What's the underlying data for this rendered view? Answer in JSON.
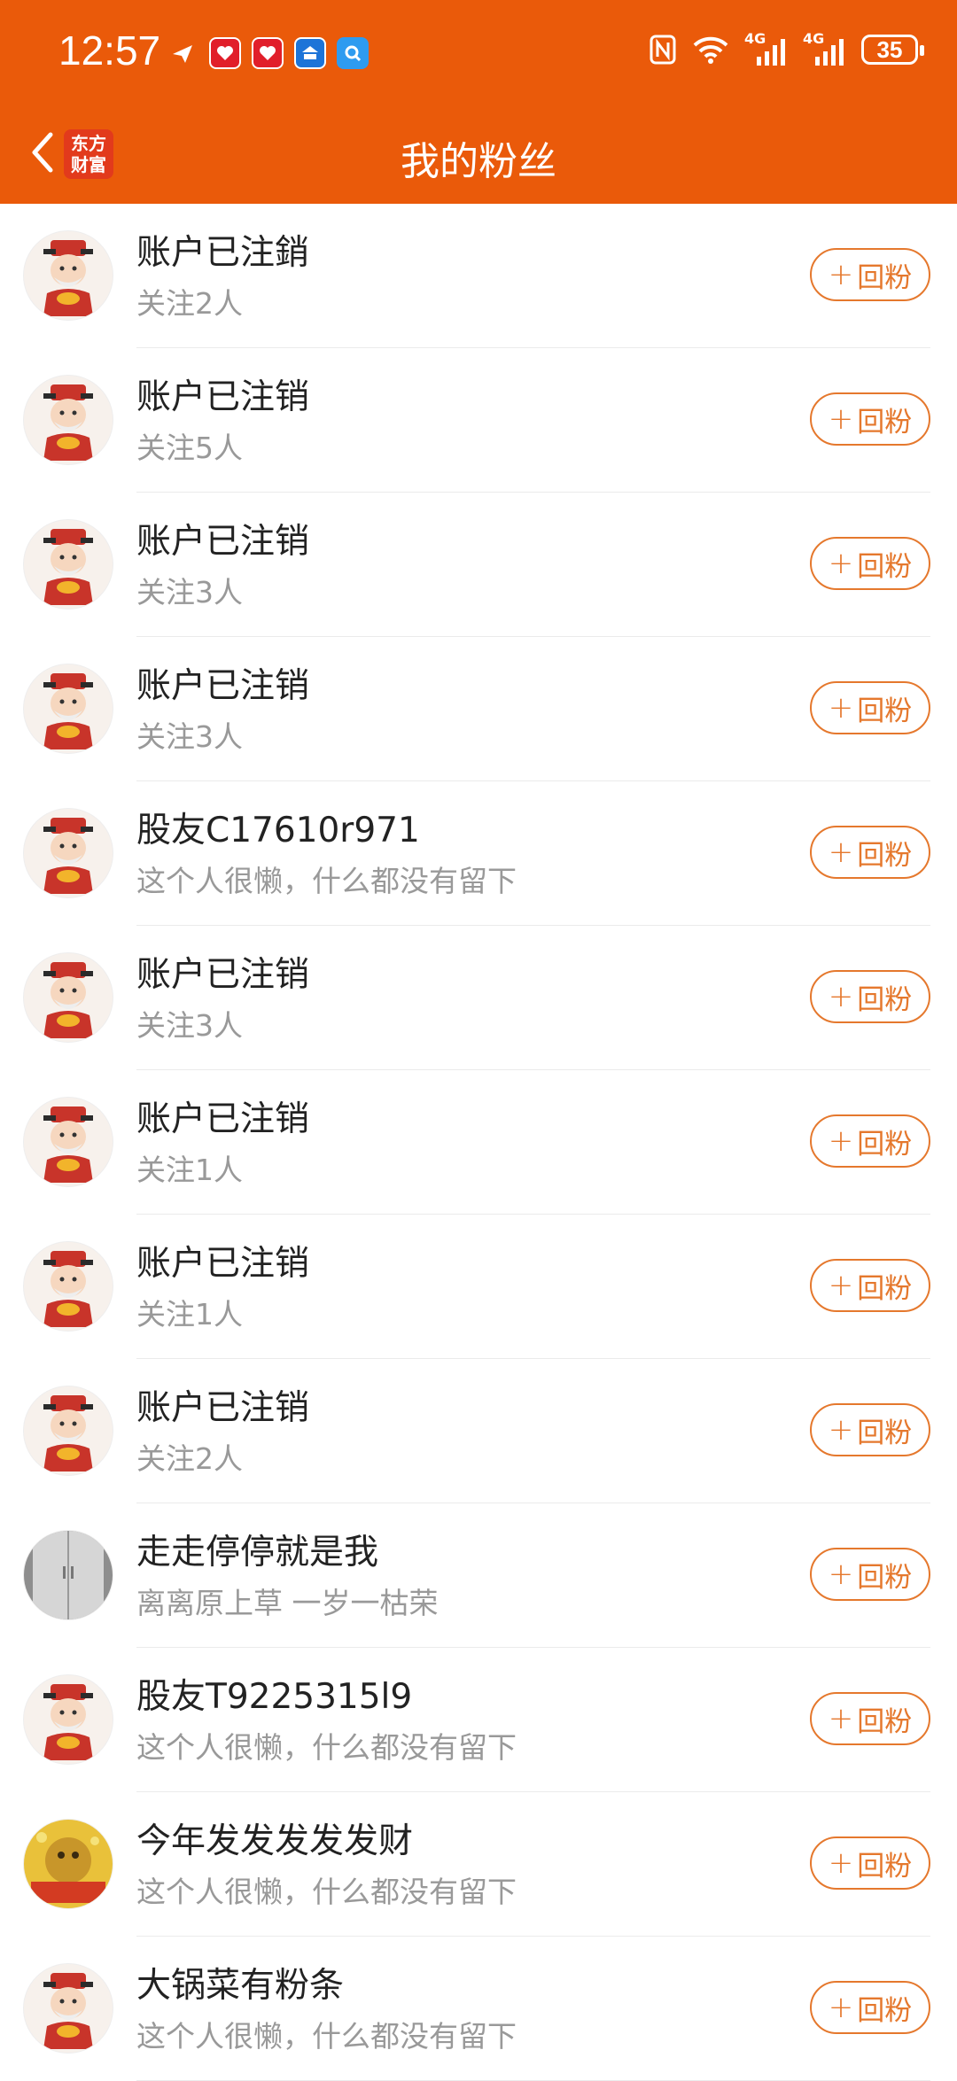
{
  "status_bar": {
    "time": "12:57",
    "battery": "35",
    "network_1": "4G",
    "network_2": "4G"
  },
  "header": {
    "title": "我的粉丝",
    "logo_line1": "东方",
    "logo_line2": "财富"
  },
  "colors": {
    "header_bg": "#EA5A0A",
    "accent": "#E5782D"
  },
  "follow_plus": "+",
  "fans": [
    {
      "name": "账户已注銷",
      "sub": "关注2人",
      "button": "回粉",
      "avatar": "caishen-avatar"
    },
    {
      "name": "账户已注销",
      "sub": "关注5人",
      "button": "回粉",
      "avatar": "caishen-avatar"
    },
    {
      "name": "账户已注销",
      "sub": "关注3人",
      "button": "回粉",
      "avatar": "caishen-avatar"
    },
    {
      "name": "账户已注销",
      "sub": "关注3人",
      "button": "回粉",
      "avatar": "caishen-avatar"
    },
    {
      "name": "股友C17610r971",
      "sub": "这个人很懒，什么都没有留下",
      "button": "回粉",
      "avatar": "caishen-avatar"
    },
    {
      "name": "账户已注销",
      "sub": "关注3人",
      "button": "回粉",
      "avatar": "caishen-avatar"
    },
    {
      "name": "账户已注销",
      "sub": "关注1人",
      "button": "回粉",
      "avatar": "caishen-avatar"
    },
    {
      "name": "账户已注销",
      "sub": "关注1人",
      "button": "回粉",
      "avatar": "caishen-avatar"
    },
    {
      "name": "账户已注销",
      "sub": "关注2人",
      "button": "回粉",
      "avatar": "caishen-avatar"
    },
    {
      "name": "走走停停就是我",
      "sub": "离离原上草 一岁一枯荣",
      "button": "回粉",
      "avatar": "photo-avatar-door"
    },
    {
      "name": "股友T9225315l9",
      "sub": "这个人很懒，什么都没有留下",
      "button": "回粉",
      "avatar": "caishen-avatar"
    },
    {
      "name": "今年发发发发发财",
      "sub": "这个人很懒，什么都没有留下",
      "button": "回粉",
      "avatar": "photo-avatar-gold"
    },
    {
      "name": "大锅菜有粉条",
      "sub": "这个人很懒，什么都没有留下",
      "button": "回粉",
      "avatar": "caishen-avatar"
    }
  ]
}
